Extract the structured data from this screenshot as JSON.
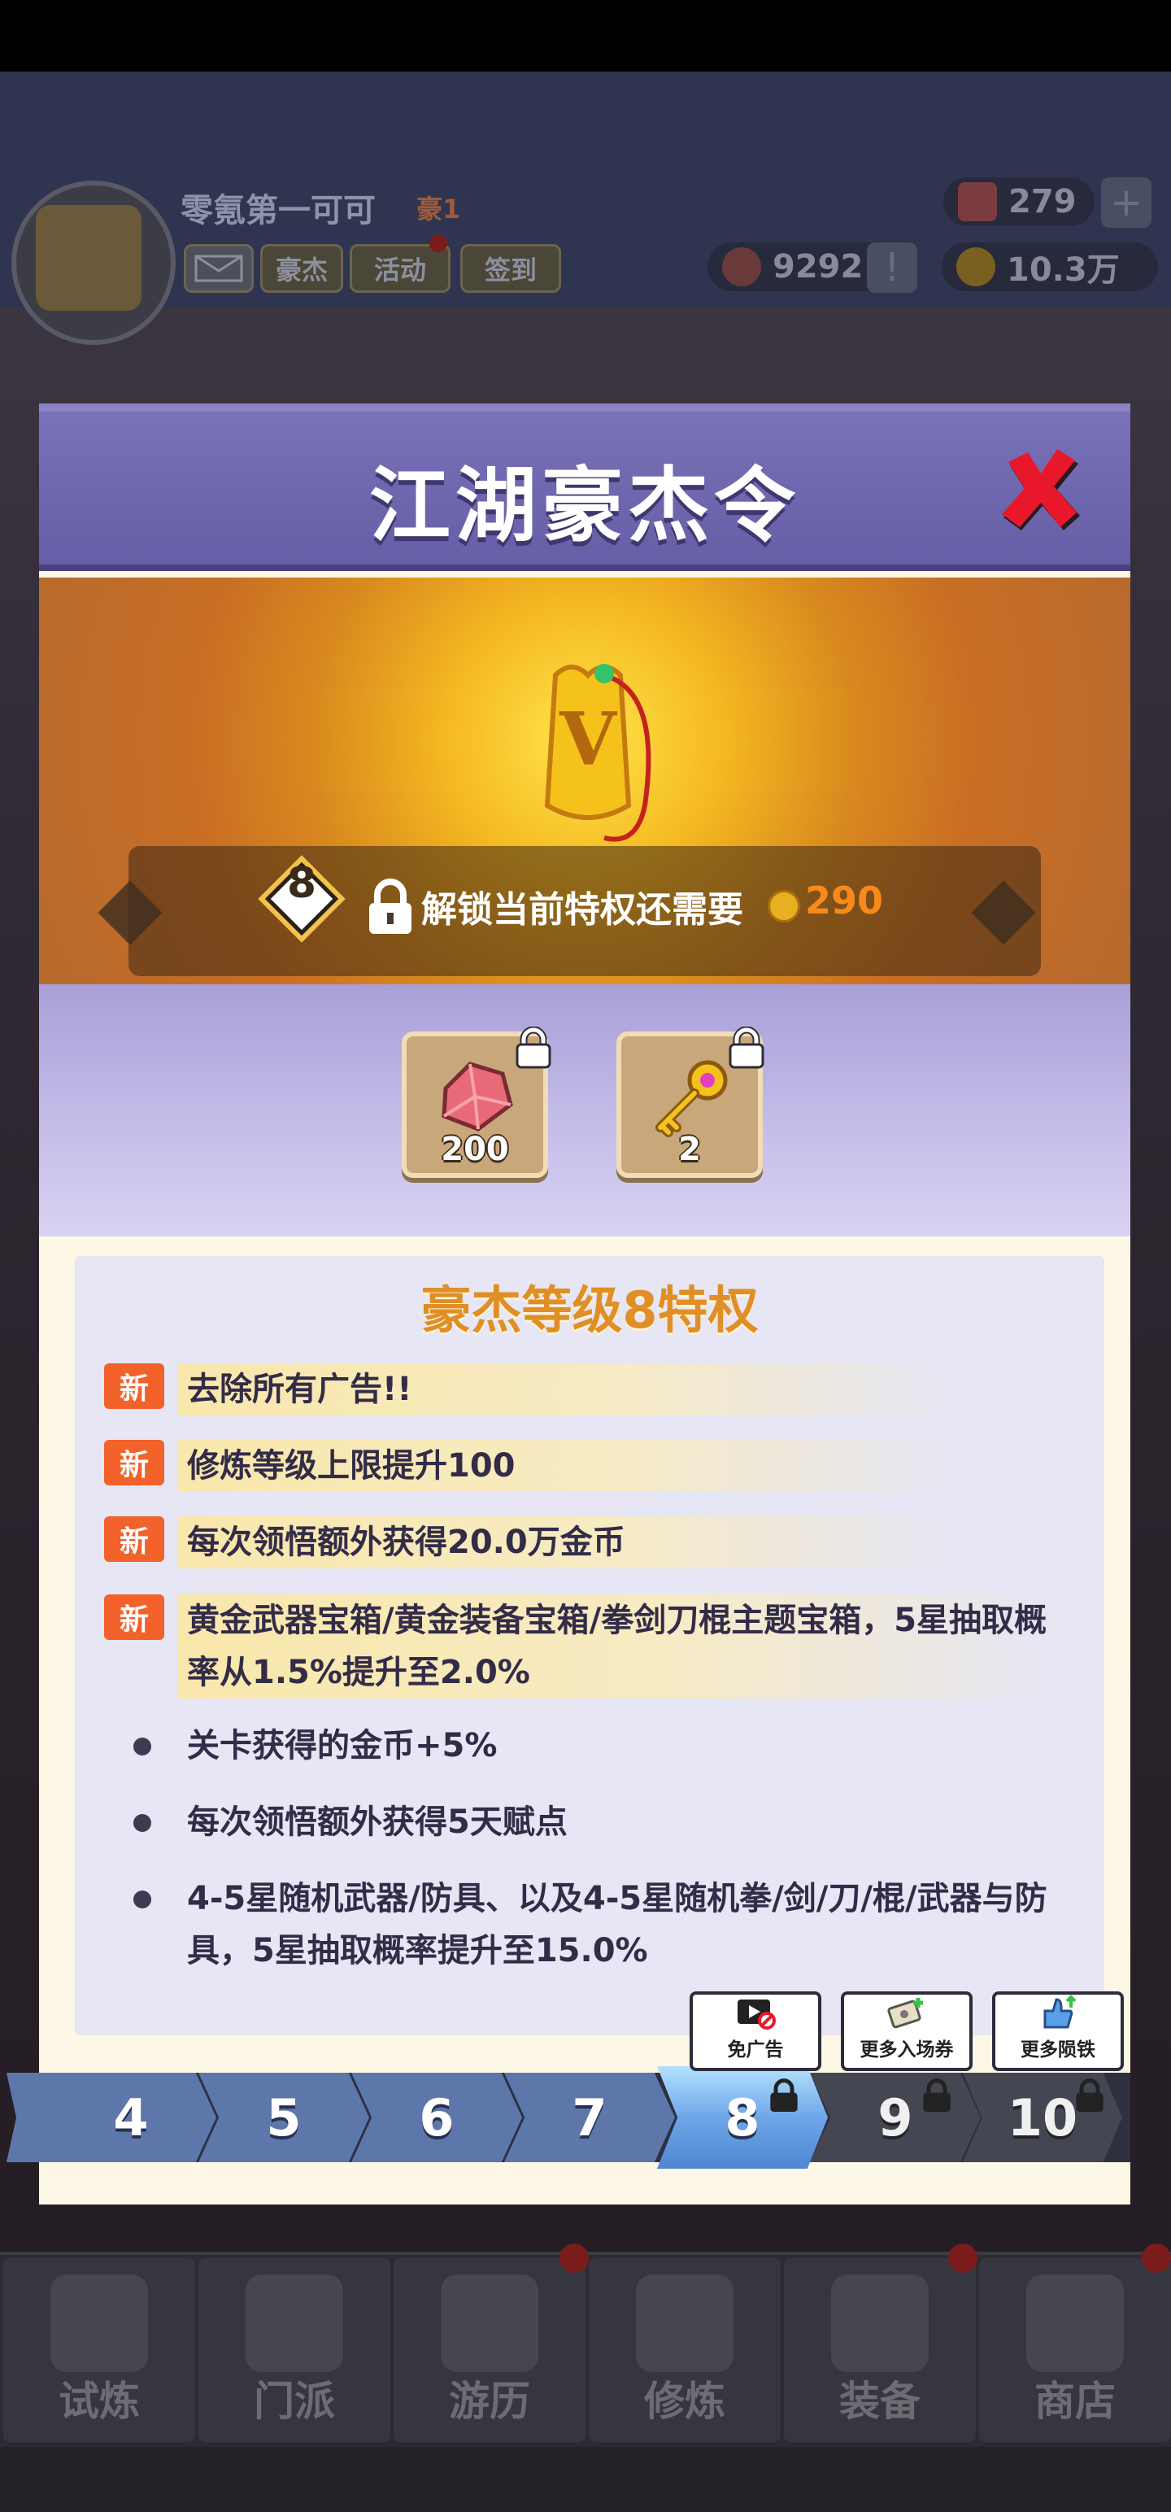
{
  "player": {
    "name": "零氪第一可可",
    "vip": "豪1"
  },
  "resources": {
    "gems": "279",
    "honor": "9292",
    "coins": "10.3万"
  },
  "top_buttons": {
    "hero": "豪杰",
    "activity": "活动",
    "checkin": "签到"
  },
  "modal": {
    "title": "江湖豪杰令",
    "current_level": "8",
    "unlock_text": "解锁当前特权还需要",
    "unlock_cost": "290",
    "rewards": [
      {
        "name": "gem",
        "count": "200"
      },
      {
        "name": "key",
        "count": "2"
      }
    ],
    "privilege_title": "豪杰等级8特权",
    "new_badge": "新",
    "privileges_new": [
      "去除所有广告!!",
      "修炼等级上限提升100",
      "每次领悟额外获得20.0万金币",
      "黄金武器宝箱/黄金装备宝箱/拳剑刀棍主题宝箱，5星抽取概率从1.5%提升至2.0%"
    ],
    "privileges_old": [
      "关卡获得的金币+5%",
      "每次领悟额外获得5天赋点",
      "4-5星随机武器/防具、以及4-5星随机拳/剑/刀/棍/武器与防具，5星抽取概率提升至15.0%"
    ],
    "levels": [
      "4",
      "5",
      "6",
      "7",
      "8",
      "9",
      "10"
    ],
    "tooltips": [
      "免广告",
      "更多入场券",
      "更多陨铁"
    ]
  },
  "bottom_nav": [
    "试炼",
    "门派",
    "游历",
    "修炼",
    "装备",
    "商店"
  ],
  "colors": {
    "accent_orange": "#f2622a",
    "header_purple": "#6d65ab",
    "cost_orange": "#f78a1a"
  }
}
